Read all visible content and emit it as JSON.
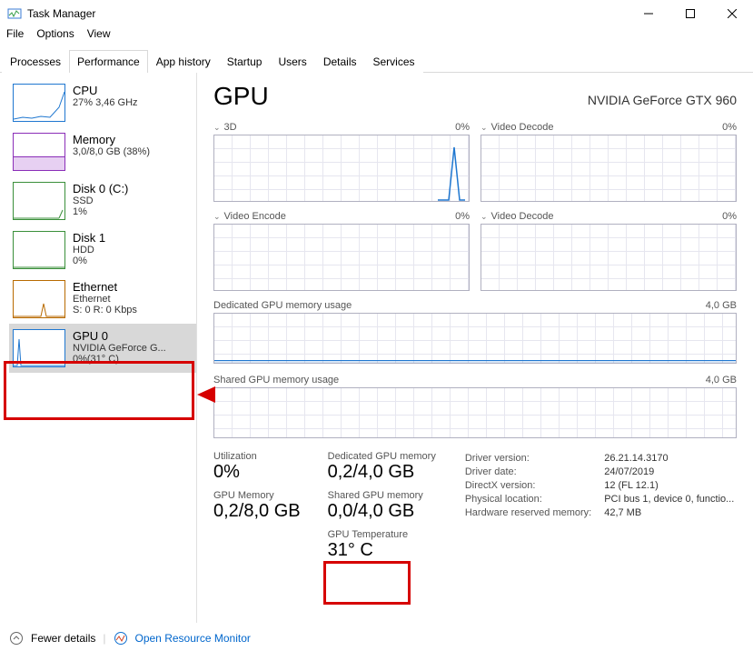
{
  "window": {
    "title": "Task Manager"
  },
  "menu": {
    "file": "File",
    "options": "Options",
    "view": "View"
  },
  "tabs": {
    "processes": "Processes",
    "performance": "Performance",
    "app_history": "App history",
    "startup": "Startup",
    "users": "Users",
    "details": "Details",
    "services": "Services"
  },
  "sidebar": {
    "cpu": {
      "title": "CPU",
      "line2": "27% 3,46 GHz",
      "line3": ""
    },
    "mem": {
      "title": "Memory",
      "line2": "3,0/8,0 GB (38%)",
      "line3": ""
    },
    "disk0": {
      "title": "Disk 0 (C:)",
      "line2": "SSD",
      "line3": "1%"
    },
    "disk1": {
      "title": "Disk 1",
      "line2": "HDD",
      "line3": "0%"
    },
    "eth": {
      "title": "Ethernet",
      "line2": "Ethernet",
      "line3": "S: 0 R: 0 Kbps"
    },
    "gpu0": {
      "title": "GPU 0",
      "line2": "NVIDIA GeForce G...",
      "line3": "0%(31° C)"
    }
  },
  "detail": {
    "title": "GPU",
    "subtitle": "NVIDIA GeForce GTX 960",
    "graphs": {
      "g3d": {
        "name": "3D",
        "right": "0%"
      },
      "vdec1": {
        "name": "Video Decode",
        "right": "0%"
      },
      "venc": {
        "name": "Video Encode",
        "right": "0%"
      },
      "vdec2": {
        "name": "Video Decode",
        "right": "0%"
      },
      "dedmem": {
        "name": "Dedicated GPU memory usage",
        "right": "4,0 GB"
      },
      "shmem": {
        "name": "Shared GPU memory usage",
        "right": "4,0 GB"
      }
    },
    "stats": {
      "util_label": "Utilization",
      "util_val": "0%",
      "gmem_label": "GPU Memory",
      "gmem_val": "0,2/8,0 GB",
      "dmem_label": "Dedicated GPU memory",
      "dmem_val": "0,2/4,0 GB",
      "smem_label": "Shared GPU memory",
      "smem_val": "0,0/4,0 GB",
      "temp_label": "GPU Temperature",
      "temp_val": "31° C"
    },
    "info": {
      "drv_ver_l": "Driver version:",
      "drv_ver_v": "26.21.14.3170",
      "drv_date_l": "Driver date:",
      "drv_date_v": "24/07/2019",
      "dx_l": "DirectX version:",
      "dx_v": "12 (FL 12.1)",
      "loc_l": "Physical location:",
      "loc_v": "PCI bus 1, device 0, functio...",
      "hwmem_l": "Hardware reserved memory:",
      "hwmem_v": "42,7 MB"
    }
  },
  "footer": {
    "fewer": "Fewer details",
    "orm": "Open Resource Monitor"
  }
}
